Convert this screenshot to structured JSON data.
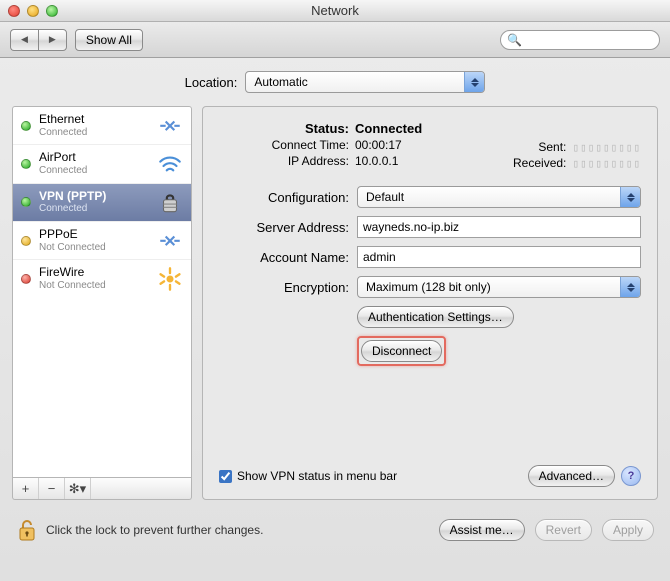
{
  "window": {
    "title": "Network"
  },
  "toolbar": {
    "back_label": "◀",
    "forward_label": "▶",
    "showall_label": "Show All",
    "search_placeholder": ""
  },
  "location": {
    "label": "Location:",
    "value": "Automatic"
  },
  "services": [
    {
      "name": "Ethernet",
      "state": "Connected",
      "dot": "green",
      "icon": "ethernet-icon",
      "selected": false
    },
    {
      "name": "AirPort",
      "state": "Connected",
      "dot": "green",
      "icon": "wifi-icon",
      "selected": false
    },
    {
      "name": "VPN (PPTP)",
      "state": "Connected",
      "dot": "green",
      "icon": "lock-icon",
      "selected": true
    },
    {
      "name": "PPPoE",
      "state": "Not Connected",
      "dot": "yellow",
      "icon": "ethernet-icon",
      "selected": false
    },
    {
      "name": "FireWire",
      "state": "Not Connected",
      "dot": "red",
      "icon": "firewire-icon",
      "selected": false
    }
  ],
  "sidefoot": {
    "add": "+",
    "remove": "−",
    "gear": "✻▾"
  },
  "status": {
    "status_label": "Status:",
    "status_value": "Connected",
    "connect_time_label": "Connect Time:",
    "connect_time_value": "00:00:17",
    "ip_label": "IP Address:",
    "ip_value": "10.0.0.1",
    "sent_label": "Sent:",
    "sent_value": "▯▯▯▯▯▯▯▯▯",
    "recv_label": "Received:",
    "recv_value": "▯▯▯▯▯▯▯▯▯"
  },
  "form": {
    "config_label": "Configuration:",
    "config_value": "Default",
    "server_label": "Server Address:",
    "server_value": "wayneds.no-ip.biz",
    "account_label": "Account Name:",
    "account_value": "admin",
    "enc_label": "Encryption:",
    "enc_value": "Maximum (128 bit only)",
    "auth_btn": "Authentication Settings…",
    "disconnect_btn": "Disconnect"
  },
  "pane_footer": {
    "menubar_label": "Show VPN status in menu bar",
    "menubar_checked": true,
    "advanced_btn": "Advanced…"
  },
  "bottom": {
    "lock_text": "Click the lock to prevent further changes.",
    "assist_btn": "Assist me…",
    "revert_btn": "Revert",
    "apply_btn": "Apply"
  }
}
